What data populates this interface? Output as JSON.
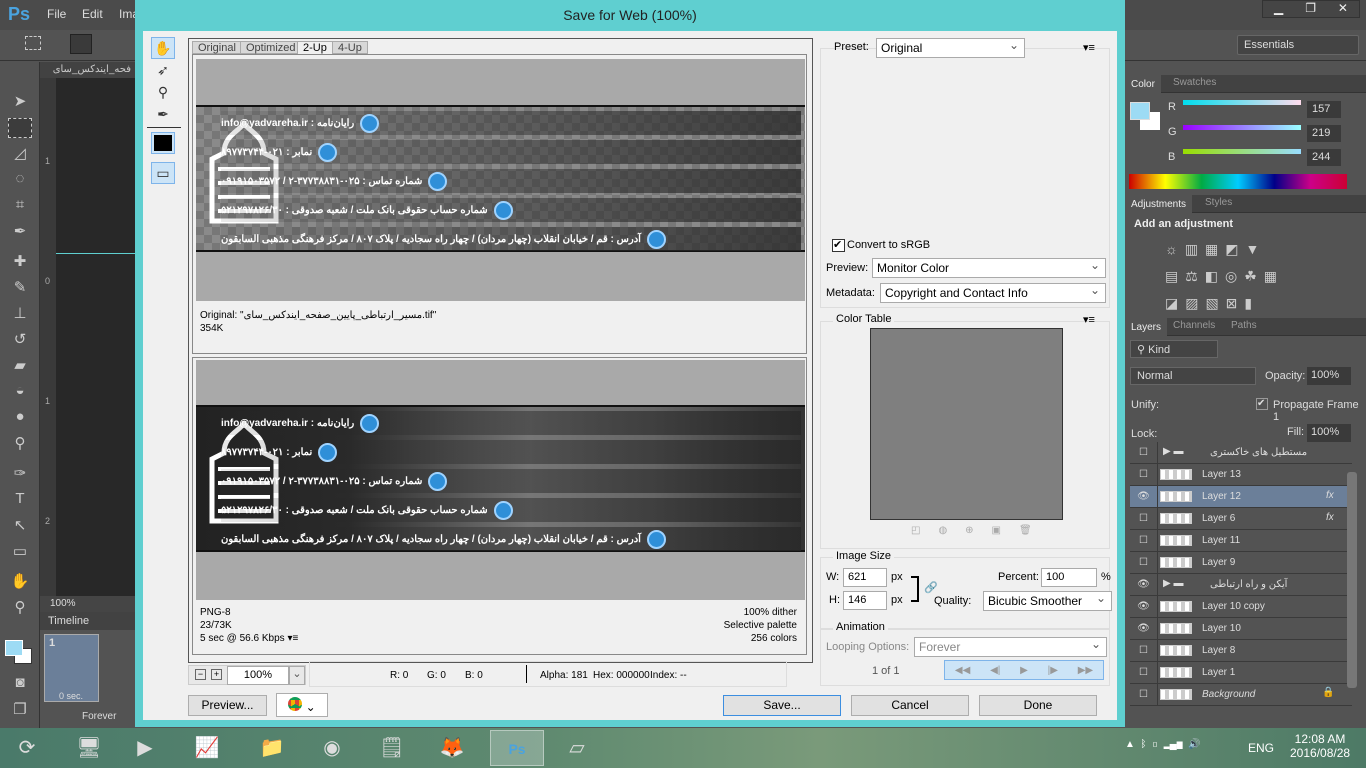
{
  "app": {
    "logo": "Ps",
    "menu": [
      "File",
      "Edit",
      "Ima"
    ]
  },
  "doc": {
    "tab": "فحه_ایندکس_سای",
    "zoom": "100%",
    "ruler": [
      "1",
      "0",
      "1",
      "2"
    ]
  },
  "timeline": {
    "title": "Timeline",
    "frame_num": "1",
    "frame_time": "0 sec.",
    "loop": "Forever"
  },
  "dialog": {
    "title": "Save for Web (100%)",
    "tabs": [
      "Original",
      "Optimized",
      "2-Up",
      "4-Up"
    ],
    "active_tab": "2-Up",
    "banner": {
      "logo_text": "یادواره شهدای فلاحا",
      "rows": [
        "رایان‌نامه :  info@yadvareha.ir",
        "نمابر :  ۰۲۱-۸۹۷۷۳۷۴۴",
        "شماره تماس :  ۰۲۵-۳۷۷۳۸۸۳۱-۲  /  ۰۹۱۹۱۵۰۳۵۷۲",
        "شماره حساب حقوقی بانک ملت / شعبه صدوقی : ۵۲۱۲۹۷۸۲۶/۳۰",
        "آدرس :  قم / خیابان انقلاب (چهار مردان) / چهار راه سجادیه / پلاک ۸۰۷  /  مرکز فرهنگی مذهبی السابقون"
      ]
    },
    "original_info": {
      "name": "Original: \"مسیر_ارتباطی_پایین_صفحه_ایندکس_سای.tif\"",
      "size": "354K"
    },
    "optimized_info": {
      "format": "PNG-8",
      "size": "23/73K",
      "time": "5 sec @ 56.6 Kbps",
      "dither": "100% dither",
      "palette": "Selective palette",
      "colors": "256 colors"
    },
    "zoom": "100%",
    "readout": {
      "r": "R: 0",
      "g": "G: 0",
      "b": "B: 0",
      "alpha": "Alpha: 181",
      "hex": "Hex: 000000",
      "index": "Index: --"
    },
    "buttons": {
      "preview": "Preview...",
      "save": "Save...",
      "cancel": "Cancel",
      "done": "Done"
    },
    "settings": {
      "preset_label": "Preset:",
      "preset": "Original",
      "convert_srgb": "Convert to sRGB",
      "convert_checked": true,
      "preview_label": "Preview:",
      "preview": "Monitor Color",
      "metadata_label": "Metadata:",
      "metadata": "Copyright and Contact Info",
      "color_table": "Color Table",
      "image_size": "Image Size",
      "w_label": "W:",
      "w": "621",
      "h_label": "H:",
      "h": "146",
      "px": "px",
      "percent_label": "Percent:",
      "percent": "100",
      "pct": "%",
      "quality_label": "Quality:",
      "quality": "Bicubic Smoother",
      "animation": "Animation",
      "looping_label": "Looping Options:",
      "looping": "Forever",
      "frame": "1 of 1"
    }
  },
  "workspace": "Essentials",
  "color_panel": {
    "tabs": [
      "Color",
      "Swatches"
    ],
    "r_label": "R",
    "r": "157",
    "g_label": "G",
    "g": "219",
    "b_label": "B",
    "b": "244",
    "fg": "#9ddbf4"
  },
  "adjustments": {
    "tabs": [
      "Adjustments",
      "Styles"
    ],
    "title": "Add an adjustment"
  },
  "layers_panel": {
    "tabs": [
      "Layers",
      "Channels",
      "Paths"
    ],
    "kind": "Kind",
    "blend": "Normal",
    "opacity_label": "Opacity:",
    "opacity": "100%",
    "unify_label": "Unify:",
    "propagate": "Propagate Frame 1",
    "lock_label": "Lock:",
    "fill_label": "Fill:",
    "fill": "100%",
    "layers": [
      {
        "name": "مستطیل های خاکستری",
        "visible": false,
        "group": true
      },
      {
        "name": "Layer 13",
        "visible": false
      },
      {
        "name": "Layer 12",
        "visible": true,
        "selected": true,
        "fx": true
      },
      {
        "name": "Layer 6",
        "visible": false,
        "fx": true
      },
      {
        "name": "Layer 11",
        "visible": false
      },
      {
        "name": "Layer 9",
        "visible": false
      },
      {
        "name": "آیکن و راه ارتباطی",
        "visible": true,
        "group": true
      },
      {
        "name": "Layer 10 copy",
        "visible": true
      },
      {
        "name": "Layer 10",
        "visible": true
      },
      {
        "name": "Layer 8",
        "visible": false
      },
      {
        "name": "Layer 1",
        "visible": false
      },
      {
        "name": "Background",
        "visible": false,
        "locked": true
      }
    ]
  },
  "taskbar": {
    "time": "12:08 AM",
    "date": "2016/08/28",
    "lang": "ENG"
  }
}
